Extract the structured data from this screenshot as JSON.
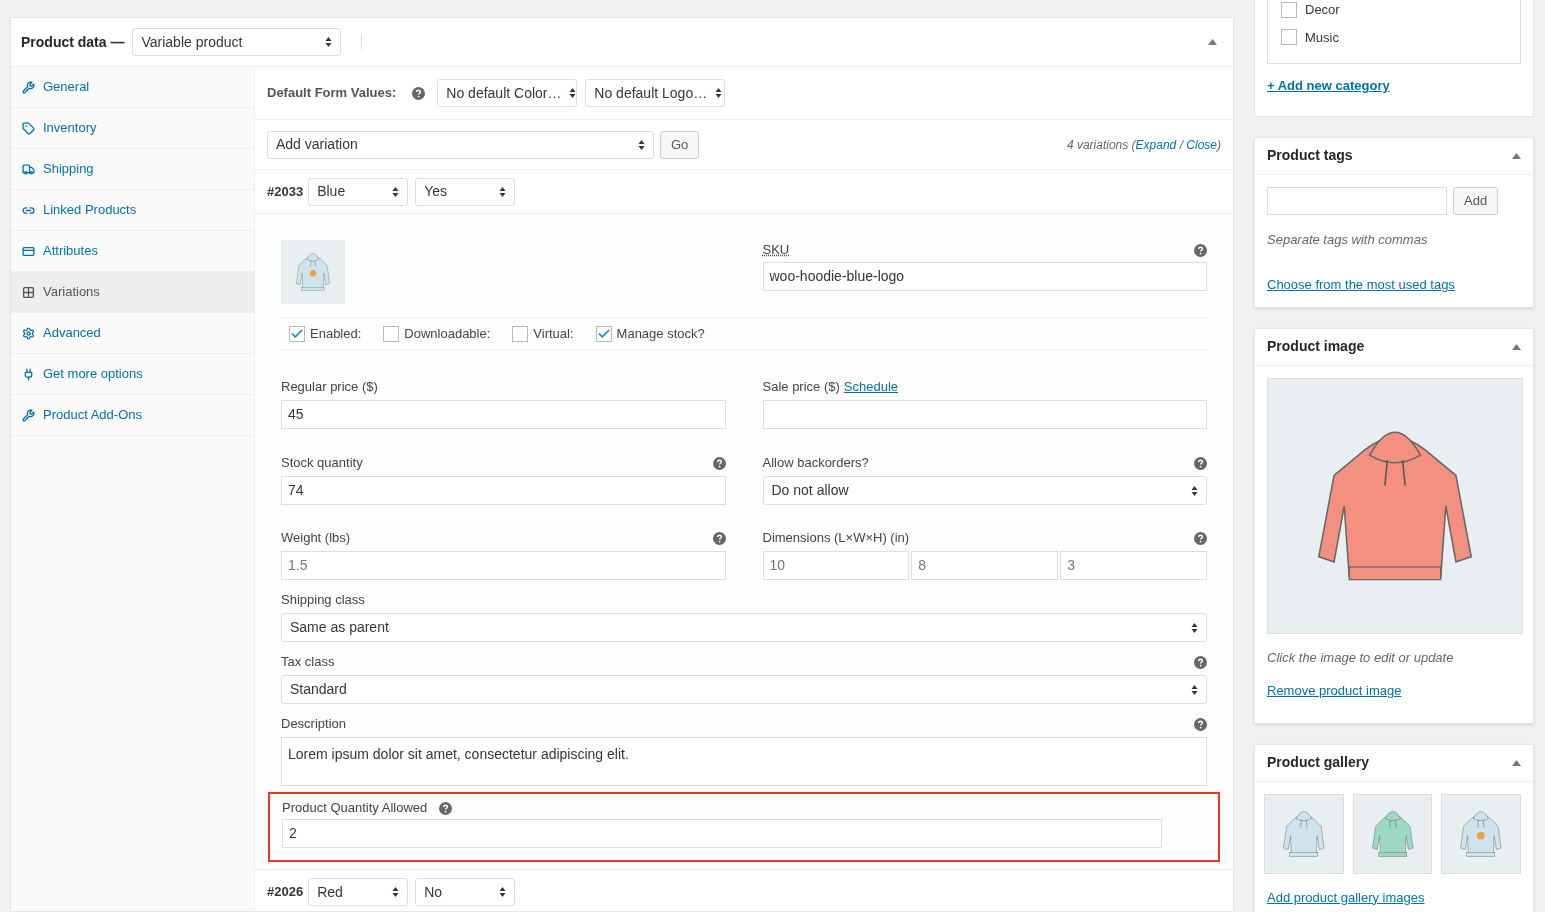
{
  "product_data": {
    "title": "Product data —",
    "type_select": "Variable product"
  },
  "tabs": [
    {
      "label": "General",
      "selected": false
    },
    {
      "label": "Inventory",
      "selected": false
    },
    {
      "label": "Shipping",
      "selected": false
    },
    {
      "label": "Linked Products",
      "selected": false
    },
    {
      "label": "Attributes",
      "selected": false
    },
    {
      "label": "Variations",
      "selected": true
    },
    {
      "label": "Advanced",
      "selected": false
    },
    {
      "label": "Get more options",
      "selected": false
    },
    {
      "label": "Product Add-Ons",
      "selected": false
    }
  ],
  "default_form_values": {
    "label": "Default Form Values:",
    "selects": [
      "No default Color…",
      "No default Logo…"
    ]
  },
  "add_variation": {
    "select": "Add variation",
    "button": "Go",
    "count": "4 variations (",
    "expand": "Expand",
    "separator": "/",
    "close": "Close",
    "end": ")"
  },
  "variations": [
    {
      "id": "#2033",
      "attributes": [
        "Blue",
        "Yes"
      ],
      "expanded": true
    },
    {
      "id": "#2026",
      "attributes": [
        "Red",
        "No"
      ],
      "expanded": false
    }
  ],
  "variation_detail": {
    "sku_label": "SKU",
    "sku": "woo-hoodie-blue-logo",
    "checkboxes": [
      {
        "label": "Enabled:",
        "checked": true
      },
      {
        "label": "Downloadable:",
        "checked": false
      },
      {
        "label": "Virtual:",
        "checked": false
      },
      {
        "label": "Manage stock?",
        "checked": true
      }
    ],
    "regular_price": {
      "label": "Regular price ($)",
      "value": "45"
    },
    "sale_price": {
      "label": "Sale price ($)",
      "link": "Schedule"
    },
    "stock_quantity": {
      "label": "Stock quantity",
      "value": "74"
    },
    "backorders": {
      "label": "Allow backorders?",
      "value": "Do not allow"
    },
    "weight": {
      "label": "Weight (lbs)",
      "placeholder": "1.5"
    },
    "dimensions": {
      "label": "Dimensions (L×W×H) (in)",
      "placeholders": [
        "10",
        "8",
        "3"
      ]
    },
    "shipping_class": {
      "label": "Shipping class",
      "value": "Same as parent"
    },
    "tax_class": {
      "label": "Tax class",
      "value": "Standard"
    },
    "description": {
      "label": "Description",
      "value": "Lorem ipsum dolor sit amet, consectetur adipiscing elit."
    },
    "quantity_allowed": {
      "label": "Product Quantity Allowed",
      "value": "2",
      "highlighted": true
    }
  },
  "categories": {
    "items": [
      {
        "label": "Decor",
        "checked": false
      },
      {
        "label": "Music",
        "checked": false
      }
    ],
    "add_link": "+ Add new category"
  },
  "product_tags": {
    "title": "Product tags",
    "button": "Add",
    "hint": "Separate tags with commas",
    "link": "Choose from the most used tags"
  },
  "product_image": {
    "title": "Product image",
    "hint": "Click the image to edit or update",
    "link": "Remove product image"
  },
  "product_gallery": {
    "title": "Product gallery",
    "link": "Add product gallery images"
  }
}
